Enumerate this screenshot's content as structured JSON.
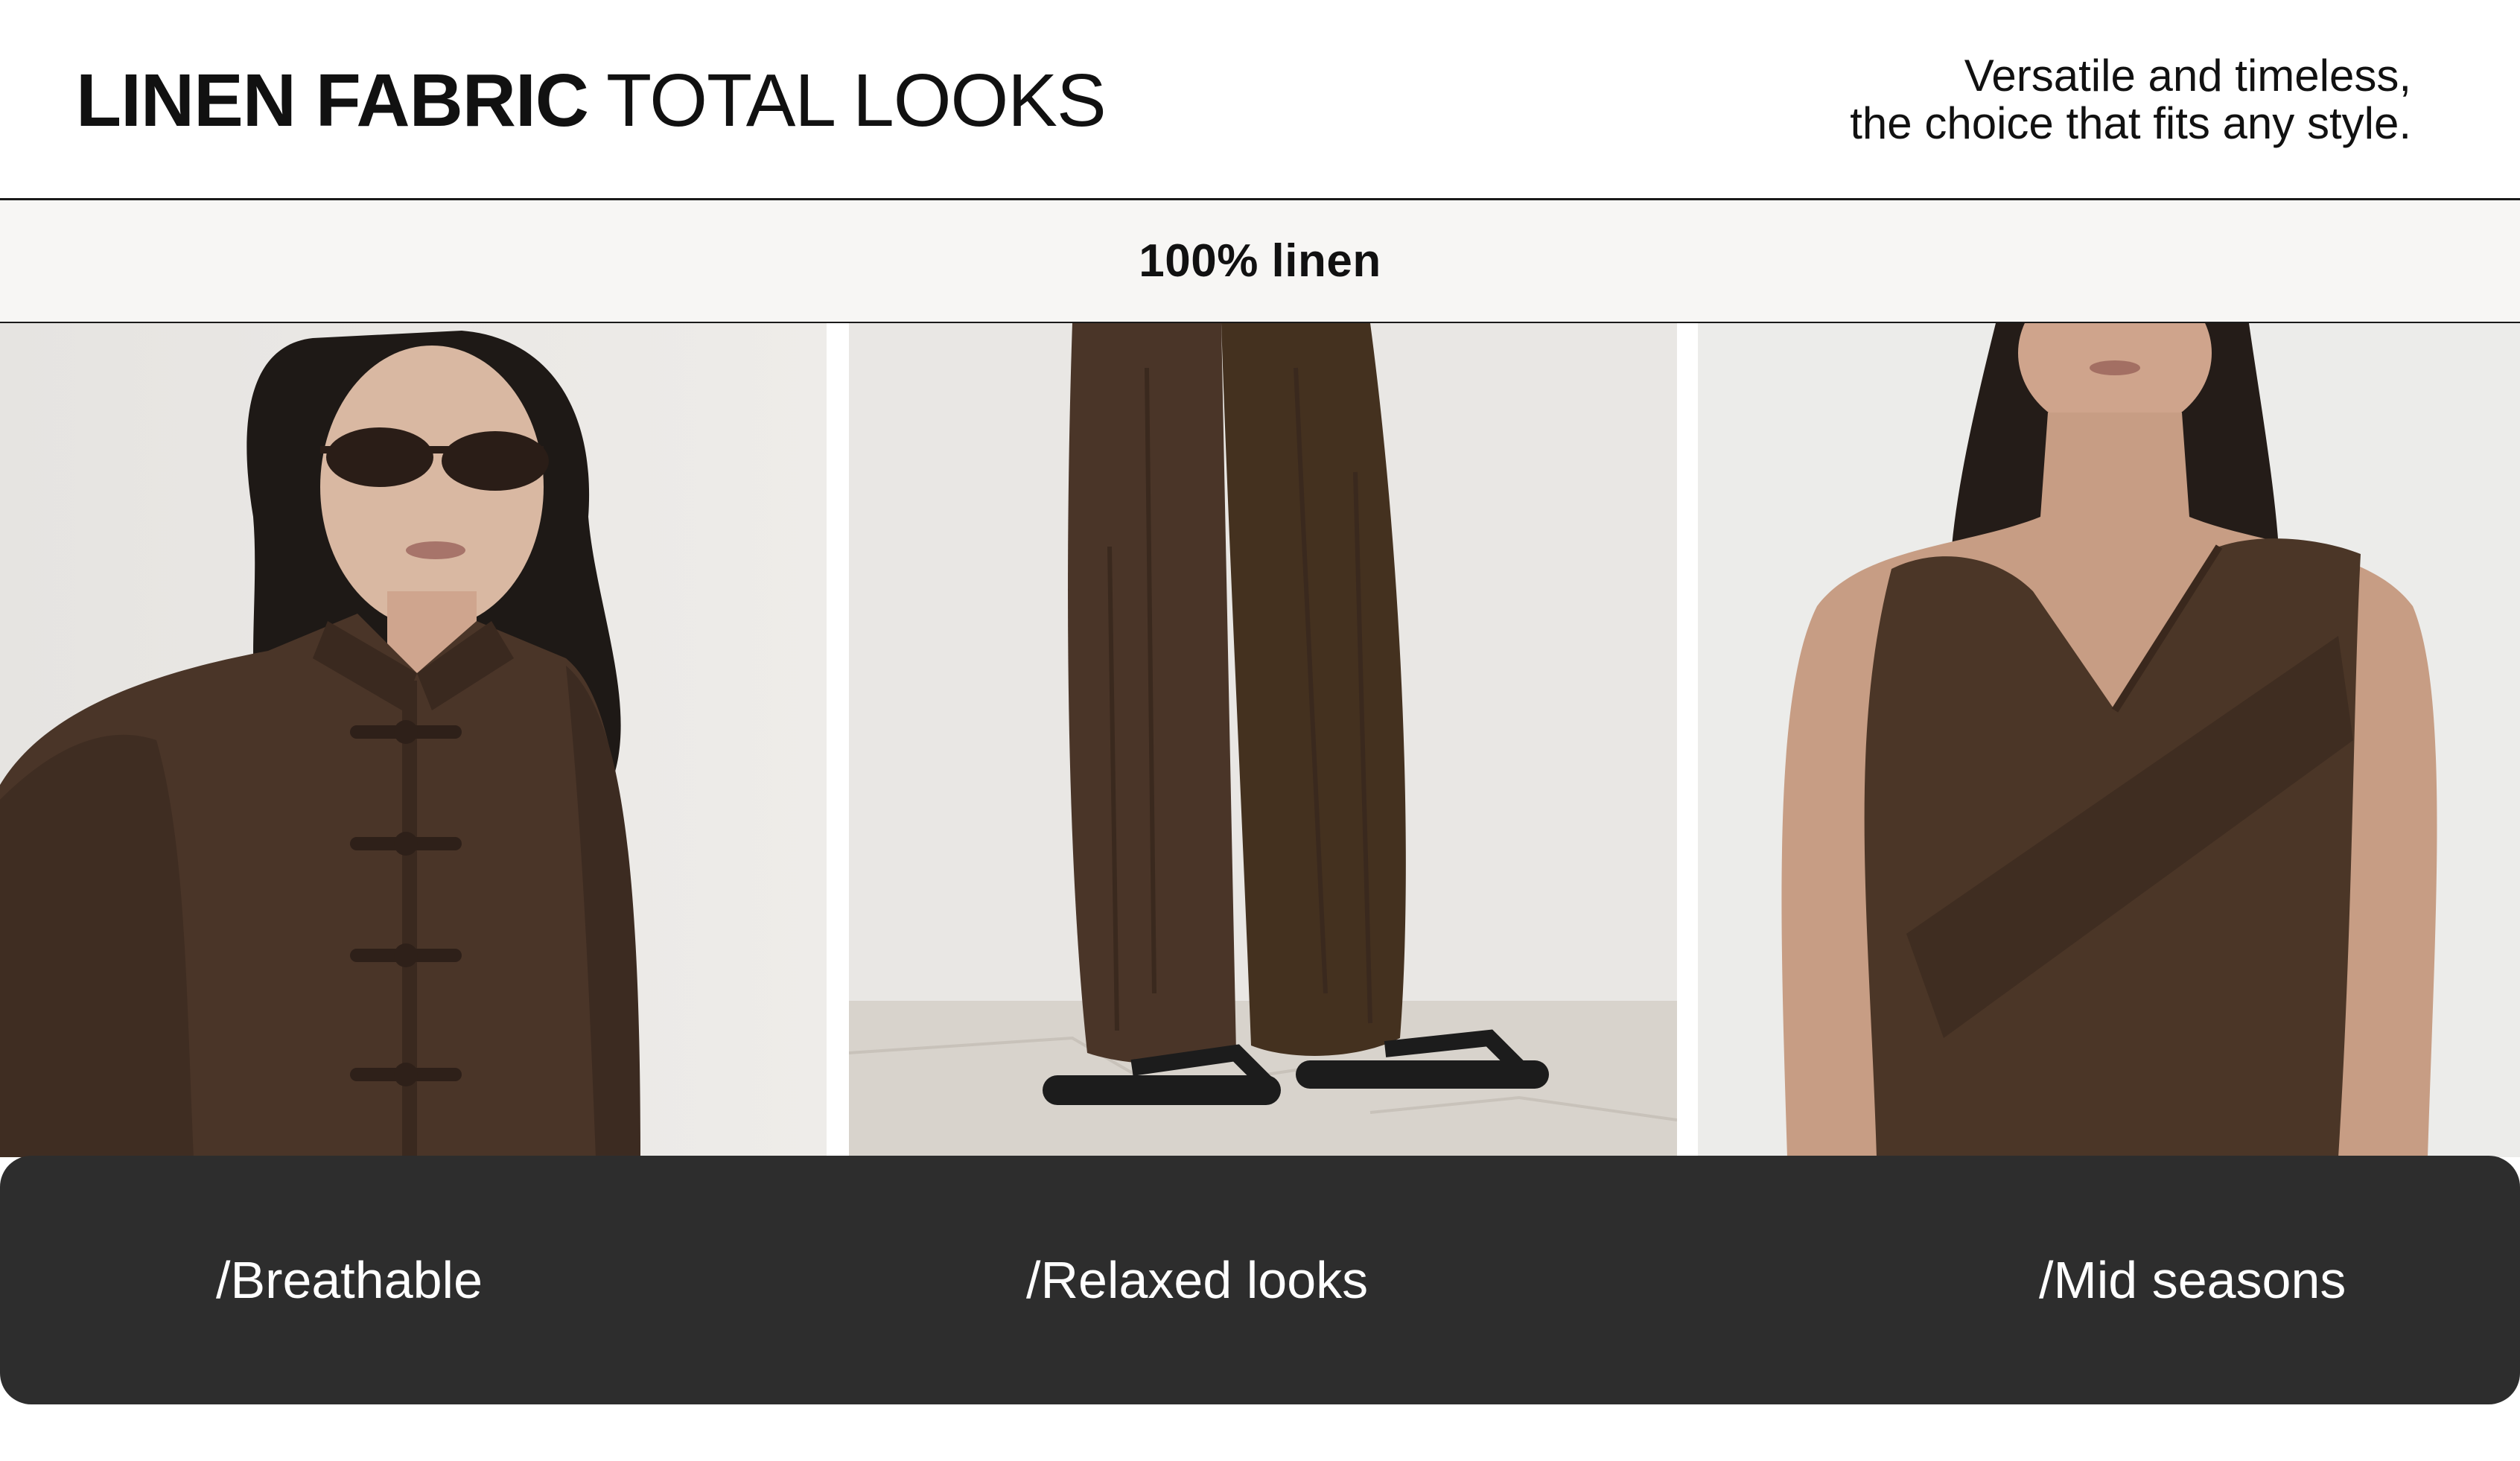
{
  "header": {
    "title_strong": "LINEN FABRIC",
    "title_light": "TOTAL LOOKS",
    "tagline_line1": "Versatile and timeless,",
    "tagline_line2": "the choice that fits any style."
  },
  "band": {
    "label": "100% linen"
  },
  "features": [
    {
      "label": "/Breathable",
      "image": "woman-in-brown-linen-shirt-with-sunglasses"
    },
    {
      "label": "/Relaxed looks",
      "image": "brown-linen-trousers-with-black-sandals"
    },
    {
      "label": "/Mid seasons",
      "image": "woman-in-brown-linen-wrap-top"
    }
  ],
  "colors": {
    "background": "#ffffff",
    "band_background": "#f7f6f4",
    "label_bar": "#2d2d2d",
    "fabric_brown": "#4a3528",
    "text": "#111111"
  }
}
